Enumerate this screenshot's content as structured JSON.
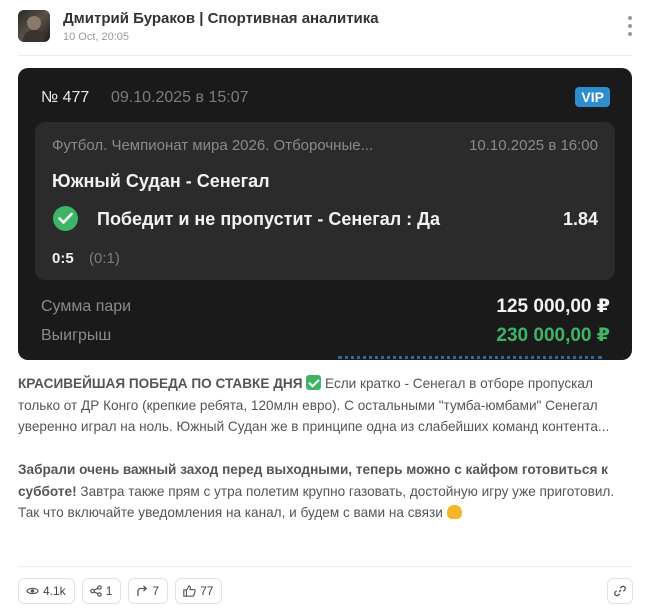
{
  "post_header": {
    "author": "Дмитрий Бураков | Спортивная аналитика",
    "date": "10 Oct, 20:05"
  },
  "bet_card": {
    "bet_number": "№ 477",
    "bet_datetime": "09.10.2025 в 15:07",
    "badge": "VIP",
    "league": "Футбол. Чемпионат мира 2026. Отборочные...",
    "match_datetime": "10.10.2025 в 16:00",
    "match": "Южный Судан - Сенегал",
    "outcome": "Победит и не пропустит - Сенегал : Да",
    "odds": "1.84",
    "score": "0:5",
    "score_halftime": "(0:1)",
    "stake_label": "Сумма пари",
    "stake_value": "125 000,00 ₽",
    "win_label": "Выигрыш",
    "win_value": "230 000,00 ₽"
  },
  "post_body": {
    "headline": "КРАСИВЕЙШАЯ ПОБЕДА ПО СТАВКЕ ДНЯ",
    "paragraph1": " Если кратко - Сенегал в отборе пропускал только от ДР Конго (крепкие ребята, 120млн евро). С остальными \"тумба-юмбами\" Сенегал уверенно играл на ноль. Южный Судан же в принципе одна из слабейших команд контента...",
    "bold2": "Забрали очень важный заход перед выходными, теперь можно с кайфом готовиться к субботе!",
    "paragraph2": " Завтра также прям с утра полетим крупно газовать, достойную игру уже приготовил. Так что включайте уведомления на канал, и будем с вами на связи "
  },
  "stats": {
    "views": "4.1k",
    "shares": "1",
    "forwards": "7",
    "likes": "77"
  },
  "colors": {
    "card_bg": "#1a1a1a",
    "inner_bg": "#2b2b2b",
    "accent_green": "#3cb567",
    "vip_blue": "#2e8ccf"
  }
}
